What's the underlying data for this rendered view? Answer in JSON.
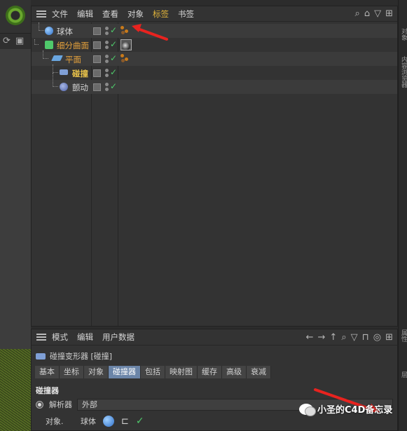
{
  "object_manager": {
    "menu": [
      "文件",
      "编辑",
      "查看",
      "对象",
      "标签",
      "书签"
    ],
    "objects": [
      {
        "name": "球体",
        "tag": "phong"
      },
      {
        "name": "细分曲面",
        "tag": "material"
      },
      {
        "name": "平面",
        "tag": "phong"
      },
      {
        "name": "碰撞",
        "tag": ""
      },
      {
        "name": "颤动",
        "tag": ""
      }
    ]
  },
  "attributes_manager": {
    "menu": [
      "模式",
      "编辑",
      "用户数据"
    ],
    "title": "碰撞变形器 [碰撞]",
    "tabs": [
      "基本",
      "坐标",
      "对象",
      "碰撞器",
      "包括",
      "映射图",
      "缓存",
      "高级",
      "衰减"
    ],
    "active_tab": "碰撞器",
    "section": "碰撞器",
    "solver_label": "解析器",
    "solver_value": "外部",
    "object_label": "对象.",
    "object_value": "球体"
  },
  "right_tabs": [
    "对象",
    "内容浏览器",
    "属性",
    "层"
  ],
  "watermark": "小圣的C4D备忘录",
  "colors": {
    "accent_orange": "#e6a23c",
    "check_green": "#4fc96b",
    "tab_active": "#6b85a8",
    "arrow_red": "#e8231f"
  }
}
